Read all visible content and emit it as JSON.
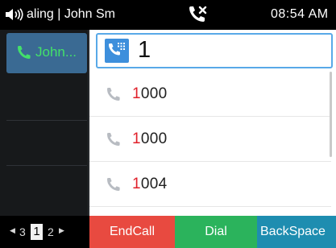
{
  "status_bar": {
    "title": "aling | John Sm",
    "time": "08:54 AM"
  },
  "line": {
    "name": "John..."
  },
  "dial": {
    "input_value": "1"
  },
  "suggestions": [
    {
      "highlight": "1",
      "rest": "000"
    },
    {
      "highlight": "1",
      "rest": "000"
    },
    {
      "highlight": "1",
      "rest": "004"
    }
  ],
  "pager": {
    "left": "3",
    "current": "1",
    "right": "2"
  },
  "softkeys": {
    "end_call": "EndCall",
    "dial": "Dial",
    "backspace": "BackSpace"
  },
  "colors": {
    "accent_blue": "#3d8fdc",
    "highlight_red": "#e0202a",
    "end_call": "#e84a40",
    "dial": "#2bb35c",
    "backspace": "#1e8db0",
    "line_name": "#43e06a"
  },
  "icons": {
    "speaker": "speaker-volume-icon",
    "missed_call": "missed-call-icon",
    "phone": "phone-icon",
    "keypad": "dialpad-icon"
  }
}
